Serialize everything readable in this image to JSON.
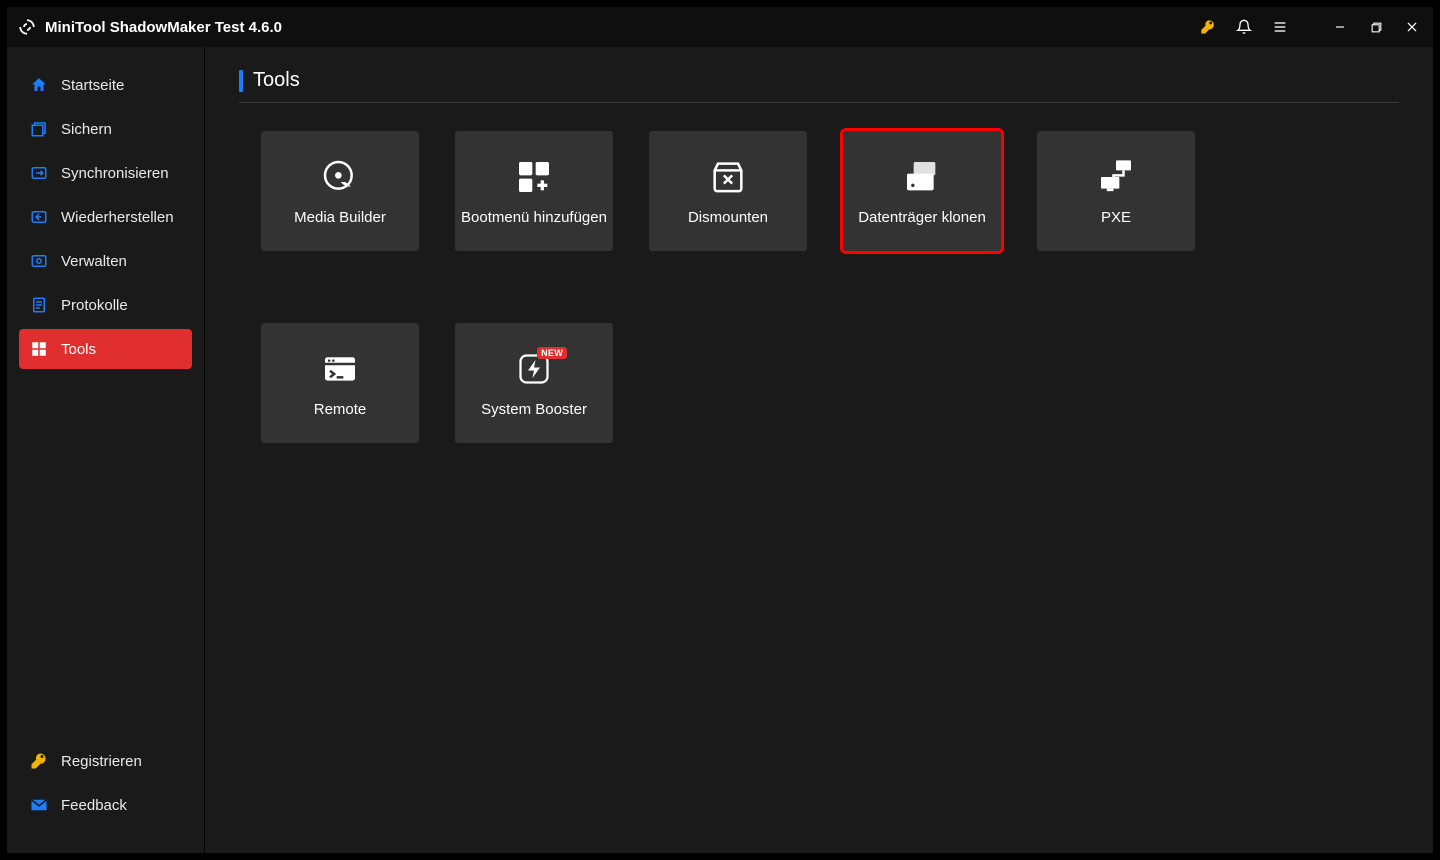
{
  "app": {
    "title": "MiniTool ShadowMaker Test 4.6.0"
  },
  "sidebar": {
    "items": [
      {
        "label": "Startseite"
      },
      {
        "label": "Sichern"
      },
      {
        "label": "Synchronisieren"
      },
      {
        "label": "Wiederherstellen"
      },
      {
        "label": "Verwalten"
      },
      {
        "label": "Protokolle"
      },
      {
        "label": "Tools"
      }
    ],
    "footer": {
      "register": "Registrieren",
      "feedback": "Feedback"
    }
  },
  "page": {
    "title": "Tools"
  },
  "tools": {
    "media_builder": "Media Builder",
    "boot_menu_add": "Bootmenü hinzufügen",
    "dismount": "Dismounten",
    "disk_clone": "Datenträger klonen",
    "pxe": "PXE",
    "remote": "Remote",
    "system_booster": "System Booster",
    "new_badge": "NEW"
  }
}
